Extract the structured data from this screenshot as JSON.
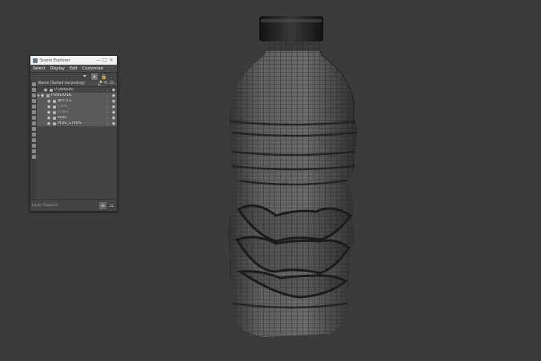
{
  "explorer": {
    "title": "Scene Explorer",
    "window_controls": [
      "—",
      "□",
      "✕"
    ],
    "menu": [
      "Select",
      "Display",
      "Edit",
      "Customize"
    ],
    "toolbar": {
      "filter_icon": "funnel-icon",
      "layers_icon": "layers-icon",
      "lock_icon": "lock-icon"
    },
    "columns": {
      "name": "Name (Sorted Ascending)",
      "frozen": "▲ F...",
      "render": "R...",
      "display": "D..."
    },
    "rows": [
      {
        "label": "0 (default)",
        "indent": 1,
        "dim": false,
        "selected": false,
        "expander": ""
      },
      {
        "label": "POWERADE",
        "indent": 0,
        "dim": false,
        "selected": true,
        "expander": "▼"
      },
      {
        "label": "BOTTLE",
        "indent": 2,
        "dim": false,
        "selected": true,
        "expander": ""
      },
      {
        "label": "CAPS",
        "indent": 2,
        "dim": true,
        "selected": true,
        "expander": ""
      },
      {
        "label": "LABEL",
        "indent": 2,
        "dim": true,
        "selected": true,
        "expander": ""
      },
      {
        "label": "PLUG",
        "indent": 2,
        "dim": false,
        "selected": true,
        "expander": ""
      },
      {
        "label": "PLUG_STRIPS",
        "indent": 2,
        "dim": false,
        "selected": true,
        "expander": ""
      }
    ],
    "footer_label": "Layer Explorer",
    "footer_buttons": [
      "≡",
      "⚏"
    ]
  },
  "colors": {
    "viewport_bg": "#3b3b3b",
    "wire": "#1a1a1a",
    "surface": "#5c5c5c",
    "cap": "#1e1e1e"
  }
}
